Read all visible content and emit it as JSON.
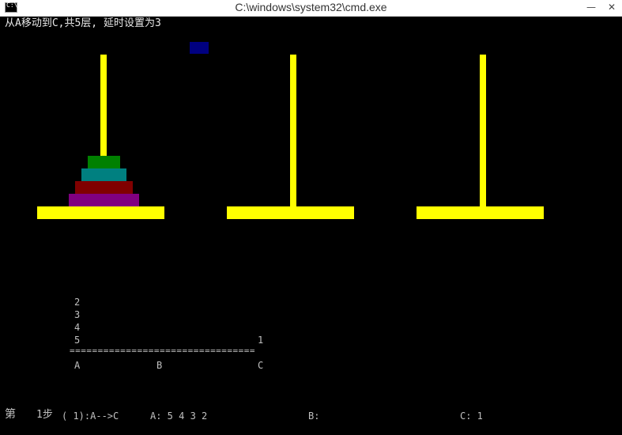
{
  "window": {
    "icon_text": "C:\\.",
    "title": "C:\\windows\\system32\\cmd.exe",
    "controls": {
      "minimize": "—",
      "close": "✕"
    }
  },
  "console": {
    "header": "从A移动到C,共5层, 延时设置为3",
    "peg_labels": {
      "a": "A",
      "b": "B",
      "c": "C"
    },
    "stack_a": [
      "2",
      "3",
      "4",
      "5"
    ],
    "stack_c": [
      "1"
    ],
    "divider": "=================================",
    "status": {
      "step_prefix": "第",
      "step_count": "1步",
      "move": "( 1):A-->C",
      "a": "A: 5 4 3 2",
      "b": "B:",
      "c": "C: 1"
    }
  },
  "colors": {
    "background": "#000000",
    "pole": "#ffff00",
    "text": "#c0c0c0",
    "moving_disk": "#000080",
    "disks": [
      "#008000",
      "#008080",
      "#800000",
      "#800080"
    ]
  },
  "tower_state": {
    "disks_total": 5,
    "peg_a": [
      5,
      4,
      3,
      2
    ],
    "peg_b": [],
    "peg_c": [],
    "in_transit": [
      1
    ]
  }
}
